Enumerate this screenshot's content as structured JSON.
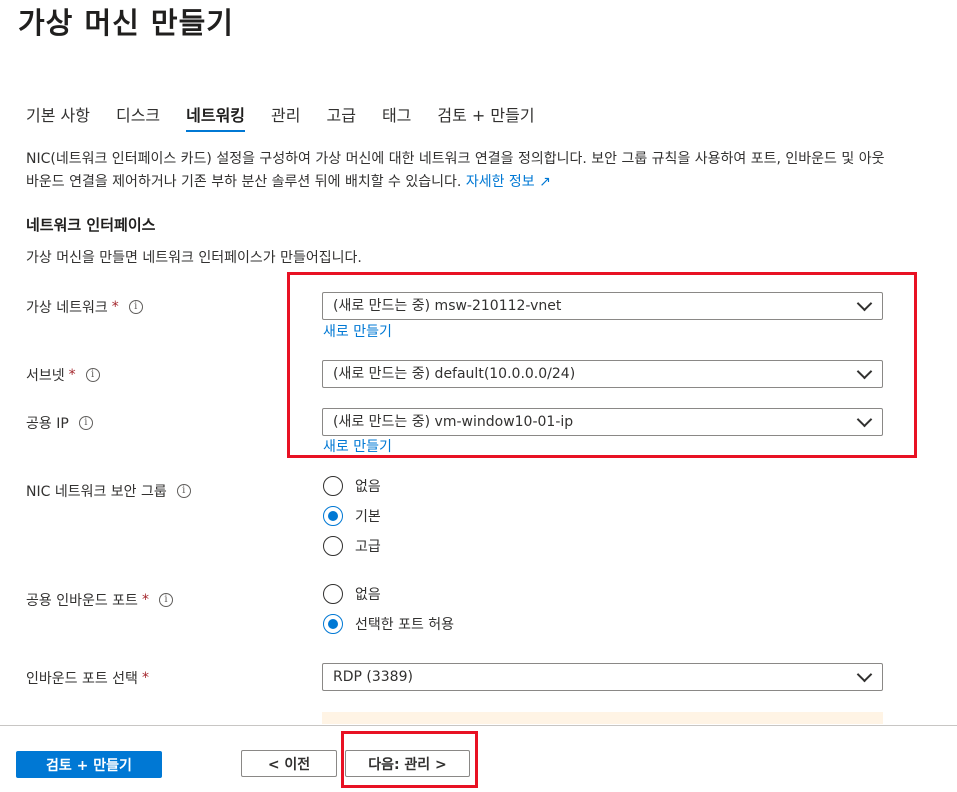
{
  "page": {
    "title": "가상 머신 만들기"
  },
  "tabs": [
    {
      "label": "기본 사항"
    },
    {
      "label": "디스크"
    },
    {
      "label": "네트워킹"
    },
    {
      "label": "관리"
    },
    {
      "label": "고급"
    },
    {
      "label": "태그"
    },
    {
      "label": "검토 + 만들기"
    }
  ],
  "description": {
    "text": "NIC(네트워크 인터페이스 카드) 설정을 구성하여 가상 머신에 대한 네트워크 연결을 정의합니다. 보안 그룹 규칙을 사용하여 포트, 인바운드 및 아웃바운드 연결을 제어하거나 기존 부하 분산 솔루션 뒤에 배치할 수 있습니다.",
    "link": "자세한 정보"
  },
  "section": {
    "title": "네트워크 인터페이스",
    "description": "가상 머신을 만들면 네트워크 인터페이스가 만들어집니다."
  },
  "fields": {
    "vnet": {
      "label": "가상 네트워크",
      "value": "(새로 만드는 중) msw-210112-vnet",
      "create_link": "새로 만들기"
    },
    "subnet": {
      "label": "서브넷",
      "value": "(새로 만드는 중) default(10.0.0.0/24)"
    },
    "public_ip": {
      "label": "공용 IP",
      "value": "(새로 만드는 중) vm-window10-01-ip",
      "create_link": "새로 만들기"
    },
    "nsg": {
      "label": "NIC 네트워크 보안 그룹",
      "options": [
        "없음",
        "기본",
        "고급"
      ],
      "selected": "기본"
    },
    "inbound_ports": {
      "label": "공용 인바운드 포트",
      "options": [
        "없음",
        "선택한 포트 허용"
      ],
      "selected": "선택한 포트 허용"
    },
    "select_ports": {
      "label": "인바운드 포트 선택",
      "value": "RDP (3389)"
    }
  },
  "required_marker": "*",
  "info_glyph": "i",
  "footer": {
    "review_button": "검토 + 만들기",
    "prev_button": "< 이전",
    "next_button": "다음: 관리 >"
  },
  "colors": {
    "accent": "#0078d4",
    "highlight": "#e81123",
    "required": "#a4262c"
  }
}
